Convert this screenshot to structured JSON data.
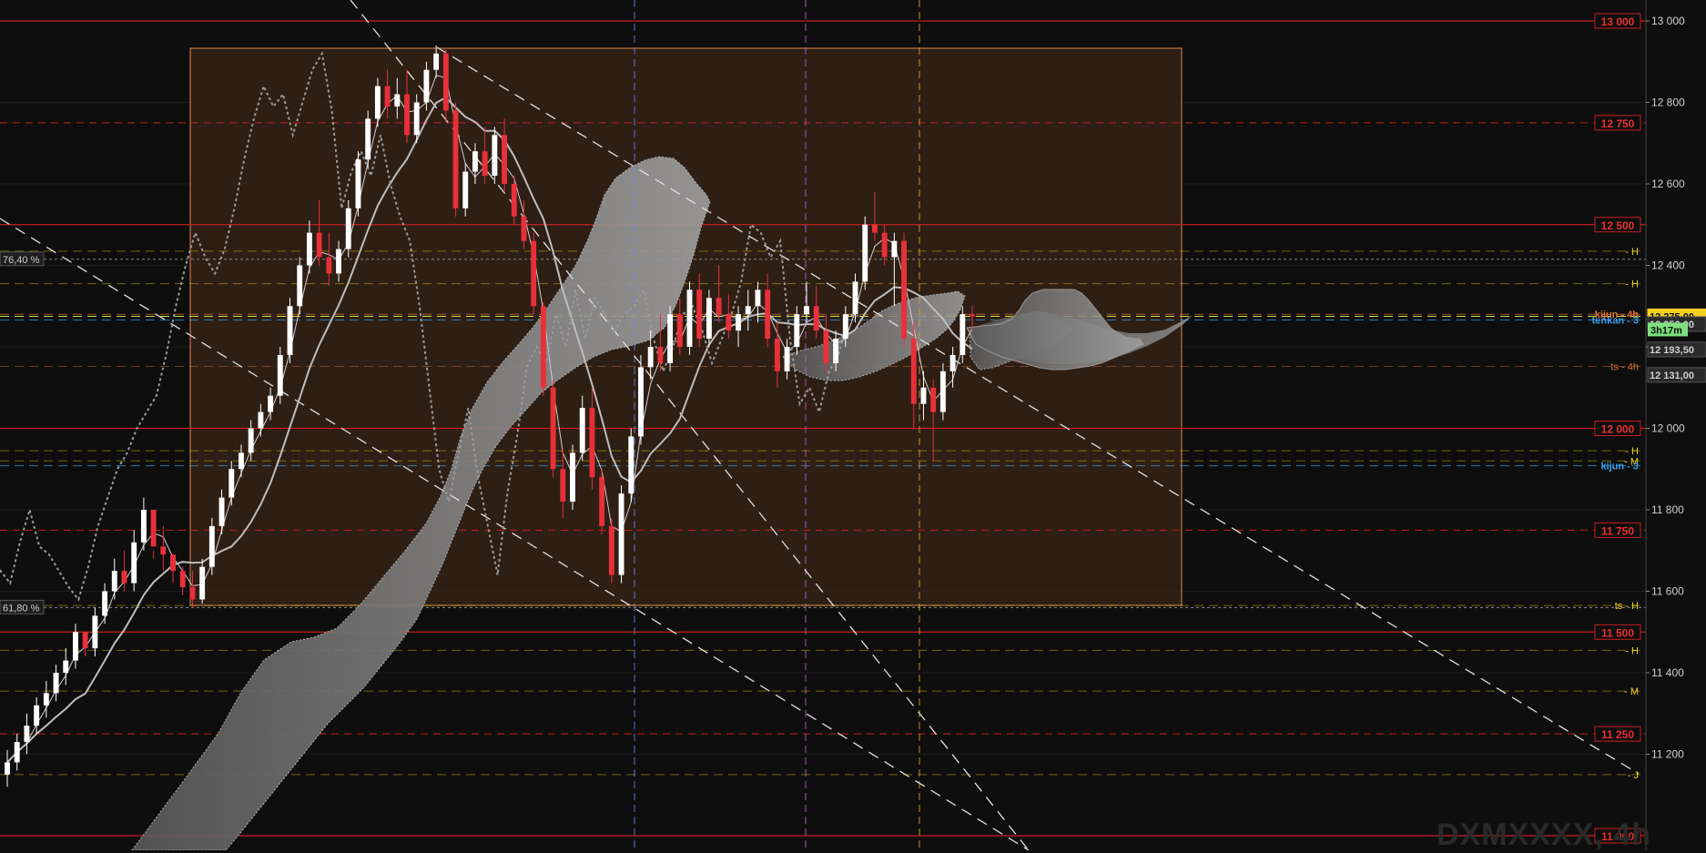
{
  "watermark": "DXMXXXX, 4h",
  "colors": {
    "background": "#0e0e0e",
    "up_candle": "#ffffff",
    "down_candle": "#e8303a",
    "cloud": "#8a8a8a",
    "box_stroke": "#e0884a",
    "box_fill": "#3a2618",
    "round_level": "#c81e1e",
    "price_tag": "#f5d020",
    "timer_tag": "#7de07d",
    "kijun_label": "#3aa0e8",
    "tenkan_label": "#e07030"
  },
  "chart_data": {
    "type": "candlestick",
    "symbol": "DXMXXXX",
    "timeframe": "4h",
    "ylim": [
      10950,
      13050
    ],
    "y_ticks": [
      {
        "value": 13000,
        "label": "13 000"
      },
      {
        "value": 12800,
        "label": "12 800"
      },
      {
        "value": 12600,
        "label": "12 600"
      },
      {
        "value": 12400,
        "label": "12 400"
      },
      {
        "value": 12200,
        "label": "12 200"
      },
      {
        "value": 12000,
        "label": "12 000"
      },
      {
        "value": 11800,
        "label": "11 800"
      },
      {
        "value": 11600,
        "label": "11 600"
      },
      {
        "value": 11400,
        "label": "11 400"
      },
      {
        "value": 11200,
        "label": "11 200"
      }
    ],
    "round_levels": [
      {
        "value": 13000,
        "label": "13 000"
      },
      {
        "value": 12750,
        "label": "12 750"
      },
      {
        "value": 12500,
        "label": "12 500"
      },
      {
        "value": 12000,
        "label": "12 000"
      },
      {
        "value": 11750,
        "label": "11 750"
      },
      {
        "value": 11500,
        "label": "11 500"
      },
      {
        "value": 11250,
        "label": "11 250"
      },
      {
        "value": 11000,
        "label": "11 000"
      }
    ],
    "fib_levels": [
      {
        "value": 12415,
        "label": "76,40 %"
      },
      {
        "value": 11560,
        "label": "61,80 %"
      }
    ],
    "level_markers": [
      {
        "value": 12435,
        "label": "- H",
        "color": "#f0d020"
      },
      {
        "value": 12355,
        "label": "- H",
        "color": "#f0d020"
      },
      {
        "value": 12152,
        "label": "ts - 4h",
        "color": "#e07030"
      },
      {
        "value": 11945,
        "label": "- H",
        "color": "#f0d020"
      },
      {
        "value": 11920,
        "label": "- M",
        "color": "#f0d020"
      },
      {
        "value": 11565,
        "label": "ts - H",
        "color": "#f0d020"
      },
      {
        "value": 11455,
        "label": "- H",
        "color": "#f0d020"
      },
      {
        "value": 11355,
        "label": "- M",
        "color": "#f0d020"
      },
      {
        "value": 11150,
        "label": "- J",
        "color": "#f0d020"
      }
    ],
    "named_lines": [
      {
        "value": 12280,
        "label": "kijun - 4h",
        "color": "#e07030"
      },
      {
        "value": 12266,
        "label": "tenkan - 3",
        "color": "#3aa0e8"
      },
      {
        "value": 11908,
        "label": "kijun - J",
        "color": "#3aa0e8"
      }
    ],
    "price_tags": [
      {
        "value": 12275,
        "label": "12 275,00",
        "kind": "last"
      },
      {
        "value": 12256,
        "label": "12 256,00",
        "kind": "grey"
      },
      {
        "value": 12193.5,
        "label": "12 193,50",
        "kind": "grey"
      },
      {
        "value": 12131,
        "label": "12 131,00",
        "kind": "grey"
      }
    ],
    "timer": "3h17m",
    "candles": [
      [
        11150,
        11210,
        11120,
        11180
      ],
      [
        11180,
        11250,
        11160,
        11230
      ],
      [
        11230,
        11300,
        11200,
        11270
      ],
      [
        11270,
        11340,
        11250,
        11320
      ],
      [
        11320,
        11380,
        11290,
        11350
      ],
      [
        11350,
        11420,
        11330,
        11400
      ],
      [
        11400,
        11460,
        11370,
        11430
      ],
      [
        11430,
        11520,
        11410,
        11500
      ],
      [
        11500,
        11480,
        11440,
        11460
      ],
      [
        11460,
        11560,
        11440,
        11540
      ],
      [
        11540,
        11620,
        11520,
        11600
      ],
      [
        11600,
        11680,
        11580,
        11650
      ],
      [
        11650,
        11700,
        11600,
        11620
      ],
      [
        11620,
        11750,
        11600,
        11720
      ],
      [
        11720,
        11830,
        11700,
        11800
      ],
      [
        11800,
        11700,
        11680,
        11710
      ],
      [
        11710,
        11760,
        11650,
        11690
      ],
      [
        11690,
        11680,
        11620,
        11650
      ],
      [
        11650,
        11660,
        11590,
        11610
      ],
      [
        11610,
        11650,
        11560,
        11580
      ],
      [
        11580,
        11680,
        11570,
        11660
      ],
      [
        11660,
        11780,
        11640,
        11760
      ],
      [
        11760,
        11850,
        11740,
        11830
      ],
      [
        11830,
        11920,
        11810,
        11900
      ],
      [
        11900,
        11960,
        11880,
        11940
      ],
      [
        11940,
        12020,
        11920,
        12000
      ],
      [
        12000,
        12060,
        11980,
        12040
      ],
      [
        12040,
        12100,
        12020,
        12080
      ],
      [
        12080,
        12200,
        12060,
        12180
      ],
      [
        12180,
        12320,
        12160,
        12300
      ],
      [
        12300,
        12420,
        12280,
        12400
      ],
      [
        12400,
        12510,
        12380,
        12480
      ],
      [
        12480,
        12560,
        12400,
        12420
      ],
      [
        12420,
        12480,
        12350,
        12380
      ],
      [
        12380,
        12460,
        12360,
        12440
      ],
      [
        12440,
        12560,
        12420,
        12540
      ],
      [
        12540,
        12680,
        12520,
        12660
      ],
      [
        12660,
        12780,
        12640,
        12760
      ],
      [
        12760,
        12860,
        12740,
        12840
      ],
      [
        12840,
        12880,
        12760,
        12790
      ],
      [
        12790,
        12860,
        12760,
        12820
      ],
      [
        12820,
        12880,
        12700,
        12720
      ],
      [
        12720,
        12820,
        12700,
        12800
      ],
      [
        12800,
        12900,
        12780,
        12880
      ],
      [
        12880,
        12940,
        12860,
        12920
      ],
      [
        12920,
        12930,
        12750,
        12780
      ],
      [
        12780,
        12800,
        12520,
        12540
      ],
      [
        12540,
        12650,
        12520,
        12630
      ],
      [
        12630,
        12700,
        12600,
        12680
      ],
      [
        12680,
        12740,
        12600,
        12620
      ],
      [
        12620,
        12740,
        12600,
        12720
      ],
      [
        12720,
        12760,
        12580,
        12600
      ],
      [
        12600,
        12620,
        12500,
        12520
      ],
      [
        12520,
        12560,
        12440,
        12460
      ],
      [
        12460,
        12480,
        12280,
        12300
      ],
      [
        12300,
        12310,
        12080,
        12100
      ],
      [
        12100,
        12120,
        11880,
        11900
      ],
      [
        11900,
        11950,
        11780,
        11820
      ],
      [
        11820,
        11960,
        11800,
        11940
      ],
      [
        11940,
        12080,
        11920,
        12050
      ],
      [
        12050,
        12100,
        11850,
        11880
      ],
      [
        11880,
        11900,
        11740,
        11760
      ],
      [
        11760,
        11780,
        11620,
        11640
      ],
      [
        11640,
        11860,
        11620,
        11840
      ],
      [
        11840,
        12000,
        11820,
        11980
      ],
      [
        11980,
        12180,
        11960,
        12150
      ],
      [
        12150,
        12240,
        12120,
        12200
      ],
      [
        12200,
        12280,
        12140,
        12160
      ],
      [
        12160,
        12300,
        12140,
        12280
      ],
      [
        12280,
        12320,
        12180,
        12200
      ],
      [
        12200,
        12360,
        12180,
        12340
      ],
      [
        12340,
        12380,
        12200,
        12220
      ],
      [
        12220,
        12340,
        12200,
        12320
      ],
      [
        12320,
        12400,
        12260,
        12280
      ],
      [
        12280,
        12330,
        12220,
        12240
      ],
      [
        12240,
        12300,
        12200,
        12280
      ],
      [
        12280,
        12340,
        12240,
        12300
      ],
      [
        12300,
        12360,
        12260,
        12340
      ],
      [
        12340,
        12380,
        12200,
        12220
      ],
      [
        12220,
        12260,
        12100,
        12140
      ],
      [
        12140,
        12220,
        12120,
        12200
      ],
      [
        12200,
        12300,
        12180,
        12280
      ],
      [
        12280,
        12360,
        12260,
        12300
      ],
      [
        12300,
        12350,
        12220,
        12240
      ],
      [
        12240,
        12280,
        12140,
        12160
      ],
      [
        12160,
        12240,
        12140,
        12220
      ],
      [
        12220,
        12300,
        12200,
        12280
      ],
      [
        12280,
        12380,
        12260,
        12360
      ],
      [
        12360,
        12520,
        12340,
        12500
      ],
      [
        12500,
        12580,
        12460,
        12480
      ],
      [
        12480,
        12500,
        12400,
        12420
      ],
      [
        12420,
        12480,
        12300,
        12460
      ],
      [
        12460,
        12480,
        12200,
        12220
      ],
      [
        12220,
        12260,
        12000,
        12060
      ],
      [
        12060,
        12140,
        12020,
        12100
      ],
      [
        12100,
        12120,
        11920,
        12040
      ],
      [
        12040,
        12160,
        12020,
        12140
      ],
      [
        12140,
        12200,
        12100,
        12180
      ],
      [
        12180,
        12300,
        12160,
        12280
      ],
      [
        12280,
        12300,
        12240,
        12275
      ]
    ]
  }
}
